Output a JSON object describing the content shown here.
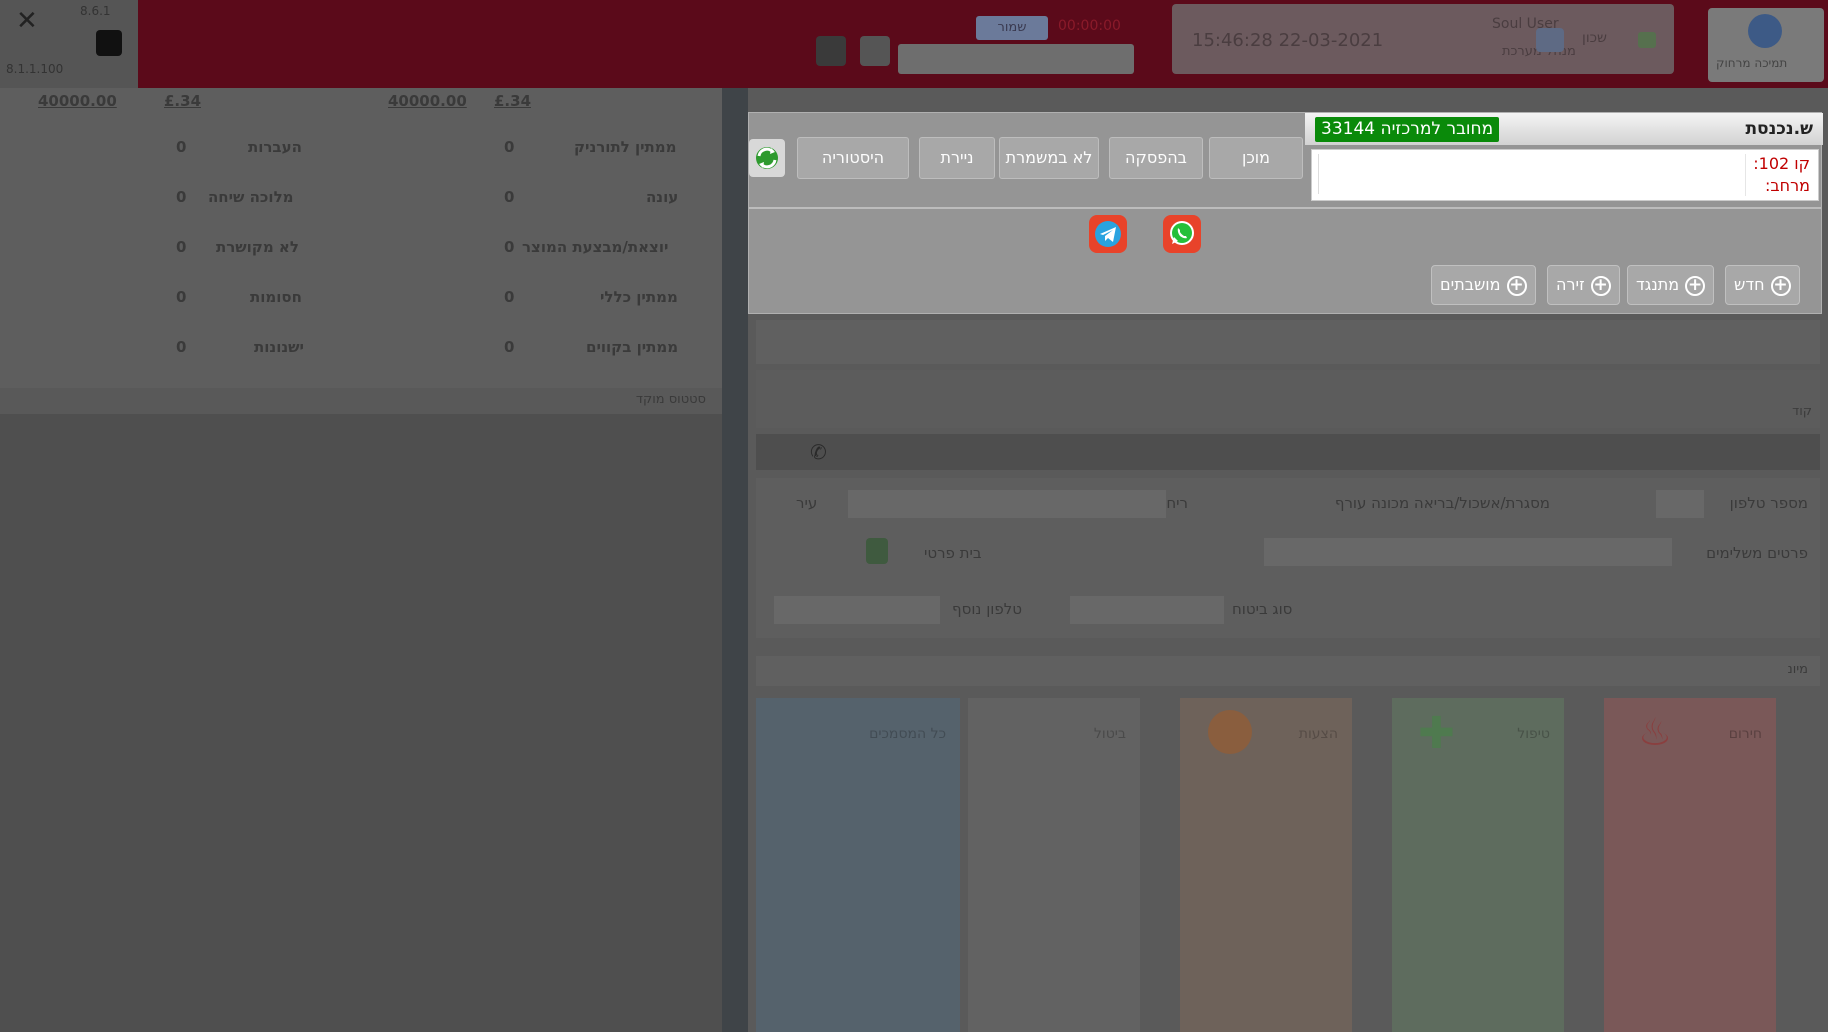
{
  "header": {
    "topbar_version": "8.6.1",
    "topbar_small": "8.1.1.100",
    "badge_text": "שמור",
    "red_text": "00:00:00",
    "status_time": "15:46:28  22-03-2021",
    "status_user": "Soul User",
    "status_role": "מנהל מערכת",
    "status_link": "שכון",
    "help_label": "תמיכה מרחוק"
  },
  "stats": {
    "headers": [
      "40000.00",
      "£.34",
      "40000.00",
      "£.34"
    ],
    "left_col": [
      {
        "label": "העברות",
        "value": "0"
      },
      {
        "label": "מלוכה שיחה",
        "value": "0"
      },
      {
        "label": "לא מקושרת",
        "value": "0"
      },
      {
        "label": "חסומות",
        "value": "0"
      },
      {
        "label": "ישנונות",
        "value": "0"
      }
    ],
    "right_col": [
      {
        "label": "ממתין לתורניק",
        "value": "0"
      },
      {
        "label": "עונה",
        "value": "0"
      },
      {
        "label": "יוצאת/מבצעת המוצר",
        "value": "0"
      },
      {
        "label": "ממתין כללי",
        "value": "0"
      },
      {
        "label": "ממתין בקווים",
        "value": "0"
      }
    ],
    "footer_label": "סטטוס מוקד"
  },
  "workspace": {
    "phone_label": "מספר טלפון",
    "branch_label": "מסגרת/אשכול/בריאה מכונה עורף",
    "name_label": "ריחוב",
    "city_label": "עיר",
    "details_label": "פרטים משלימים",
    "house_label": "בית פרטי",
    "job_label": "סוג ביטוח",
    "origin_label": "טלפון נוסף",
    "notes_label": "מיונ",
    "sub_label": "קוד",
    "columns": [
      "חירום",
      "טיפול",
      "הצעות",
      "ביטול",
      "כל המסמכים"
    ]
  },
  "popup": {
    "title": "ש.נכנסת",
    "connected_badge": "33144 מחובר למרכזיה",
    "line_label": "קו 102:",
    "extension_label": "מרחב:",
    "buttons": {
      "ready": "מוכן",
      "pause": "בהפסקה",
      "not_on_shift": "לא במשמרת",
      "paperwork": "ניירת",
      "history": "היסטוריה"
    },
    "add_buttons": {
      "new": "חדש",
      "opponent": "מתנגד",
      "arena": "זירה",
      "settlements": "מושבתים"
    },
    "messaging": [
      "whatsapp",
      "telegram"
    ]
  },
  "colors": {
    "header_bg": "#5b0a1a",
    "connected_green": "#0a8a0a",
    "line_red": "#c00000",
    "col_red": "#7a5858",
    "col_green": "#5e6c5e",
    "col_orange": "#6e625a",
    "col_gray": "#626262",
    "col_blue": "#55626c"
  },
  "icons": [
    "close-icon",
    "lock-icon",
    "help-icon",
    "refresh-icon",
    "whatsapp-icon",
    "telegram-icon",
    "plus-icon",
    "phone-icon"
  ]
}
